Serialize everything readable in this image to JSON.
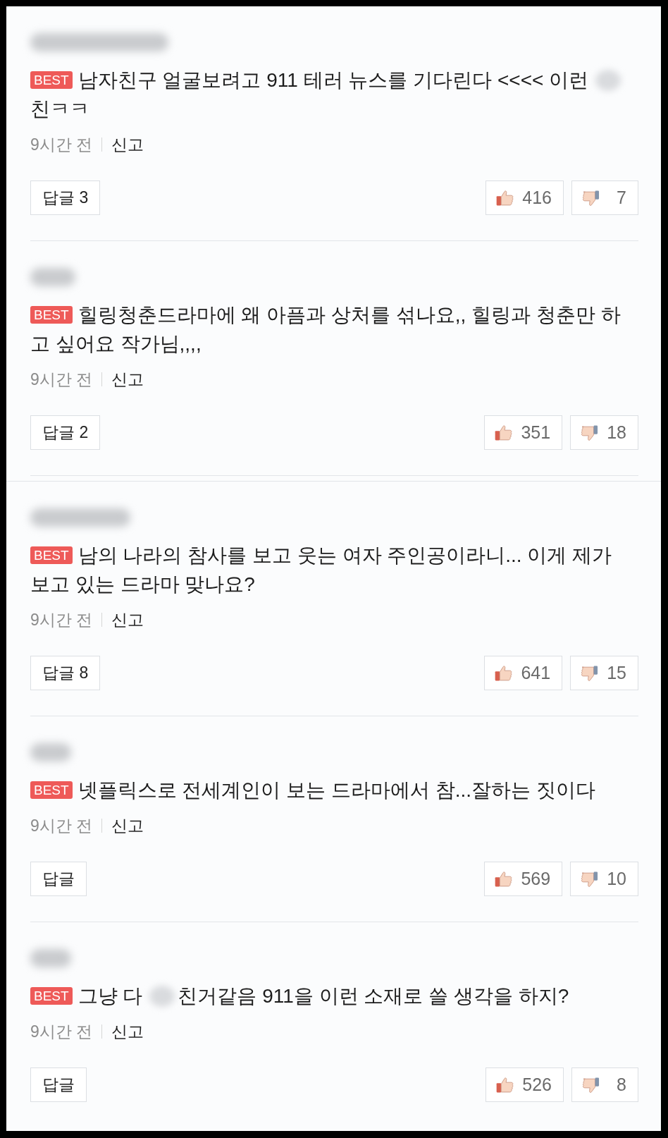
{
  "comments": [
    {
      "badge": "BEST",
      "lines": [
        [
          {
            "kind": "text",
            "text": "남자친구 얼굴보려고 911 테러 뉴스를 기다린다 <<<< 이런"
          },
          {
            "kind": "blurred"
          }
        ],
        [
          {
            "kind": "text",
            "text": "친ㅋㅋ"
          }
        ]
      ],
      "time": "9시간 전",
      "report": "신고",
      "reply": "답글 3",
      "likes": "416",
      "dislikes": "7"
    },
    {
      "badge": "BEST",
      "lines": [
        [
          {
            "kind": "text",
            "text": "힐링청춘드라마에 왜 아픔과 상처를 섞나요,, 힐링과 청춘만 하"
          }
        ],
        [
          {
            "kind": "text",
            "text": "고 싶어요 작가님,,,,"
          }
        ]
      ],
      "time": "9시간 전",
      "report": "신고",
      "reply": "답글 2",
      "likes": "351",
      "dislikes": "18"
    },
    {
      "badge": "BEST",
      "lines": [
        [
          {
            "kind": "text",
            "text": "남의 나라의 참사를 보고 웃는 여자 주인공이라니... 이게 제가"
          }
        ],
        [
          {
            "kind": "text",
            "text": "보고 있는 드라마 맞나요?"
          }
        ]
      ],
      "time": "9시간 전",
      "report": "신고",
      "reply": "답글 8",
      "likes": "641",
      "dislikes": "15"
    },
    {
      "badge": "BEST",
      "lines": [
        [
          {
            "kind": "text",
            "text": "넷플릭스로 전세계인이 보는 드라마에서 참...잘하는 짓이다"
          }
        ]
      ],
      "time": "9시간 전",
      "report": "신고",
      "reply": "답글",
      "likes": "569",
      "dislikes": "10"
    },
    {
      "badge": "BEST",
      "lines": [
        [
          {
            "kind": "text",
            "text": "그냥 다"
          },
          {
            "kind": "blurred"
          },
          {
            "kind": "text",
            "text": "친거같음 911을 이런 소재로 쓸 생각을 하지?"
          }
        ]
      ],
      "time": "9시간 전",
      "report": "신고",
      "reply": "답글",
      "likes": "526",
      "dislikes": "8"
    }
  ]
}
